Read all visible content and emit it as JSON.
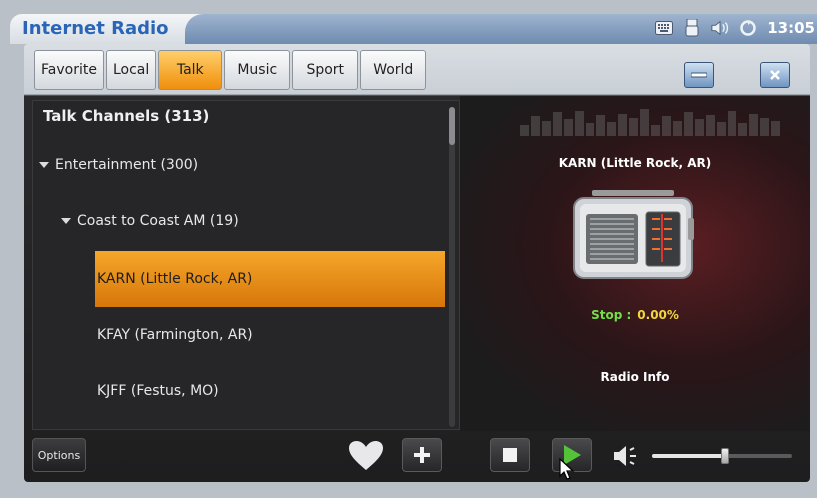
{
  "app": {
    "title": "Internet Radio",
    "clock": "13:05"
  },
  "tabs": [
    {
      "label": "Favorite",
      "active": false
    },
    {
      "label": "Local",
      "active": false
    },
    {
      "label": "Talk",
      "active": true
    },
    {
      "label": "Music",
      "active": false
    },
    {
      "label": "Sport",
      "active": false
    },
    {
      "label": "World",
      "active": false
    }
  ],
  "channels_panel": {
    "title": "Talk Channels (313)",
    "category": "Entertainment (300)",
    "subcategory": "Coast to Coast AM (19)",
    "stations": [
      {
        "name": "KARN (Little Rock, AR)",
        "selected": true
      },
      {
        "name": "KFAY (Farmington, AR)",
        "selected": false
      },
      {
        "name": "KJFF (Festus, MO)",
        "selected": false
      }
    ]
  },
  "player": {
    "station": "KARN (Little Rock, AR)",
    "status_label": "Stop :",
    "progress": "0.00%",
    "info_label": "Radio Info"
  },
  "controls": {
    "options_label": "Options",
    "volume_level": 0.52
  },
  "colors": {
    "accent": "#ef8f0c",
    "title_blue": "#2a66b8",
    "status_green": "#73e04a",
    "status_yellow": "#f1d73a"
  },
  "icons": [
    "keyboard-icon",
    "usb-icon",
    "speaker-icon",
    "sync-icon",
    "minimize-icon",
    "close-icon",
    "heart-icon",
    "plus-icon",
    "stop-icon",
    "play-icon",
    "volume-icon",
    "radio-icon"
  ]
}
